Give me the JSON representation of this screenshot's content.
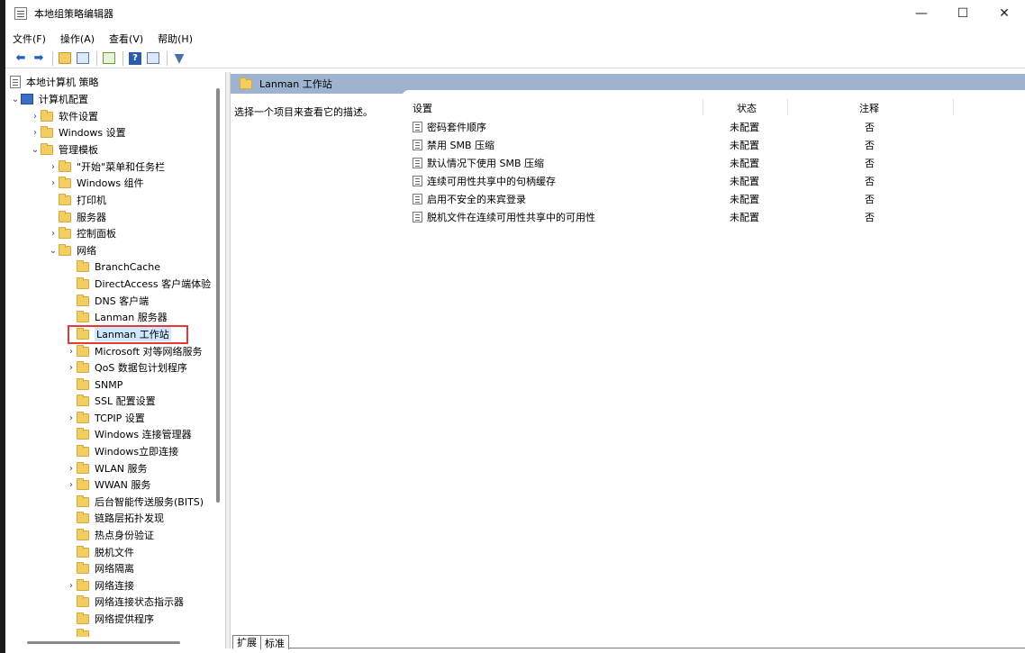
{
  "window": {
    "title": "本地组策略编辑器",
    "minimize": "—",
    "maximize": "☐",
    "close": "✕"
  },
  "menu": [
    "文件(F)",
    "操作(A)",
    "查看(V)",
    "帮助(H)"
  ],
  "tree": {
    "root": "本地计算机 策略",
    "computer_config": "计算机配置",
    "software": "软件设置",
    "windows_settings": "Windows 设置",
    "admin_templates": "管理模板",
    "start_menu": "\"开始\"菜单和任务栏",
    "windows_components": "Windows 组件",
    "printer": "打印机",
    "server": "服务器",
    "control_panel": "控制面板",
    "network": "网络",
    "branchcache": "BranchCache",
    "directaccess": "DirectAccess 客户端体验",
    "dns": "DNS 客户端",
    "lanman_server": "Lanman 服务器",
    "lanman_workstation": "Lanman 工作站",
    "microsoft_p2p": "Microsoft 对等网络服务",
    "qos": "QoS 数据包计划程序",
    "snmp": "SNMP",
    "ssl": "SSL 配置设置",
    "tcpip": "TCPIP 设置",
    "windows_conn_mgr": "Windows 连接管理器",
    "windows_now": "Windows立即连接",
    "wlan": "WLAN 服务",
    "wwan": "WWAN 服务",
    "bits": "后台智能传送服务(BITS)",
    "link_layer": "链路层拓扑发现",
    "hotspot": "热点身份验证",
    "offline_files": "脱机文件",
    "net_isolation": "网络隔离",
    "net_connections": "网络连接",
    "net_status": "网络连接状态指示器",
    "net_provider": "网络提供程序"
  },
  "right": {
    "header": "Lanman 工作站",
    "description": "选择一个项目来查看它的描述。",
    "columns": {
      "setting": "设置",
      "state": "状态",
      "comment": "注释"
    },
    "rows": [
      {
        "setting": "密码套件顺序",
        "state": "未配置",
        "comment": "否"
      },
      {
        "setting": "禁用 SMB 压缩",
        "state": "未配置",
        "comment": "否"
      },
      {
        "setting": "默认情况下使用 SMB 压缩",
        "state": "未配置",
        "comment": "否"
      },
      {
        "setting": "连续可用性共享中的句柄缓存",
        "state": "未配置",
        "comment": "否"
      },
      {
        "setting": "启用不安全的来宾登录",
        "state": "未配置",
        "comment": "否"
      },
      {
        "setting": "脱机文件在连续可用性共享中的可用性",
        "state": "未配置",
        "comment": "否"
      }
    ]
  },
  "tabs": [
    "扩展",
    "标准"
  ]
}
